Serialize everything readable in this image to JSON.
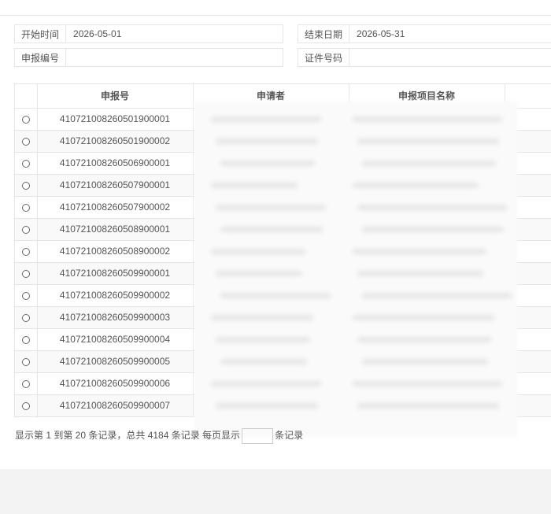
{
  "filters": {
    "start_label": "开始时间",
    "start_value": "2026-05-01",
    "end_label": "结束日期",
    "end_value": "2026-05-31",
    "report_no_label": "申报编号",
    "report_no_value": "",
    "cert_label": "证件号码",
    "cert_value": ""
  },
  "table": {
    "headers": [
      "申报号",
      "申请者",
      "申报项目名称"
    ],
    "rows": [
      "410721008260501900001",
      "410721008260501900002",
      "410721008260506900001",
      "410721008260507900001",
      "410721008260507900002",
      "410721008260508900001",
      "410721008260508900002",
      "410721008260509900001",
      "410721008260509900002",
      "410721008260509900003",
      "410721008260509900004",
      "410721008260509900005",
      "410721008260509900006",
      "410721008260509900007"
    ]
  },
  "pagination": {
    "summary": "显示第 1 到第 20 条记录，总共 4184 条记录 每页显示",
    "suffix": "条记录"
  },
  "colors": {
    "border": "#e5e6e7",
    "stripe": "#f9f9f9",
    "action": "#d9534f",
    "footer": "#f3f3f4"
  }
}
